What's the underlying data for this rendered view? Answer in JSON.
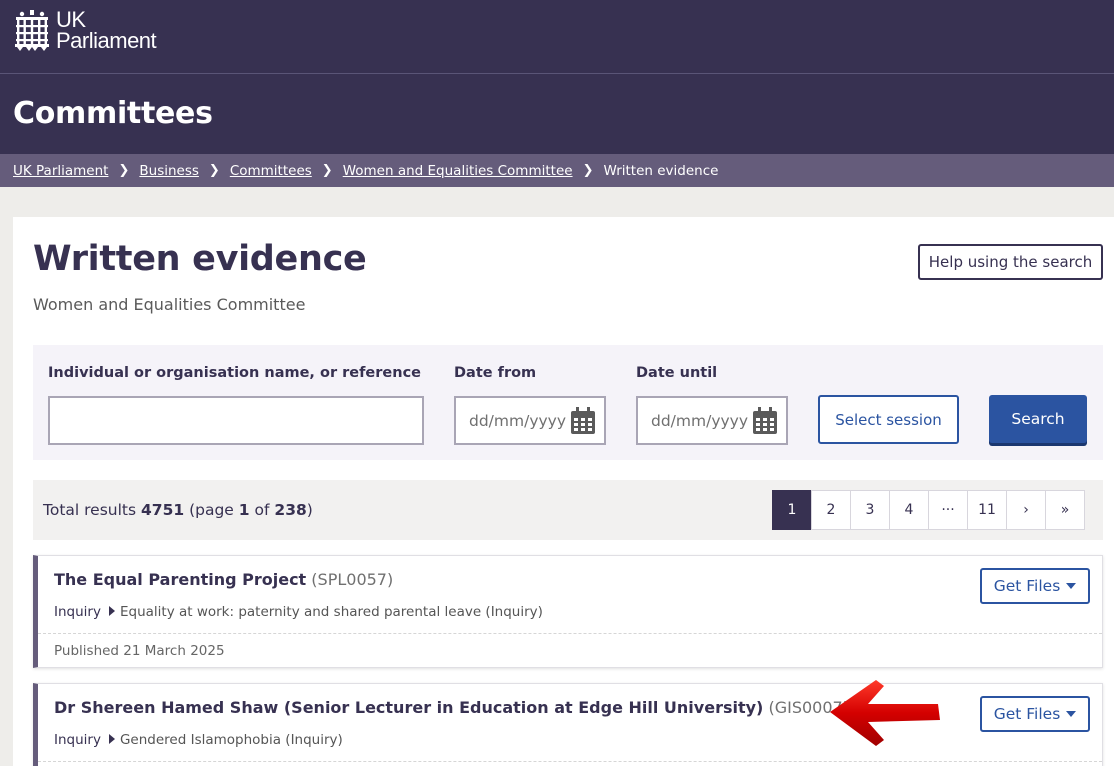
{
  "header": {
    "logo_line1": "UK",
    "logo_line2": "Parliament",
    "section_title": "Committees"
  },
  "breadcrumb": {
    "items": [
      "UK Parliament",
      "Business",
      "Committees",
      "Women and Equalities Committee"
    ],
    "current": "Written evidence"
  },
  "page": {
    "title": "Written evidence",
    "subtitle": "Women and Equalities Committee",
    "help_label": "Help using the search"
  },
  "search": {
    "name_label": "Individual or organisation name, or reference",
    "name_value": "",
    "date_from_label": "Date from",
    "date_until_label": "Date until",
    "date_placeholder": "dd/mm/yyyy",
    "session_label": "Select session",
    "search_label": "Search"
  },
  "results": {
    "prefix": "Total results",
    "total": "4751",
    "page_word": "(page",
    "page": "1",
    "of_word": "of",
    "pages": "238",
    "suffix": ")",
    "pager": [
      "1",
      "2",
      "3",
      "4",
      "···",
      "11",
      "›",
      "»"
    ]
  },
  "cards": [
    {
      "name": "The Equal Parenting Project",
      "ref": "(SPL0057)",
      "inquiry_label": "Inquiry",
      "inquiry_name": "Equality at work: paternity and shared parental leave (Inquiry)",
      "published": "Published 21 March 2025",
      "files_label": "Get Files"
    },
    {
      "name": "Dr Shereen Hamed Shaw (Senior Lecturer in Education at Edge Hill University)",
      "ref": "(GIS0007)",
      "inquiry_label": "Inquiry",
      "inquiry_name": "Gendered Islamophobia (Inquiry)",
      "files_label": "Get Files"
    }
  ],
  "colors": {
    "brand": "#373151",
    "accent": "#2b54a1",
    "breadcrumb_bg": "#655c7b",
    "annotation_arrow": "#d40000"
  }
}
